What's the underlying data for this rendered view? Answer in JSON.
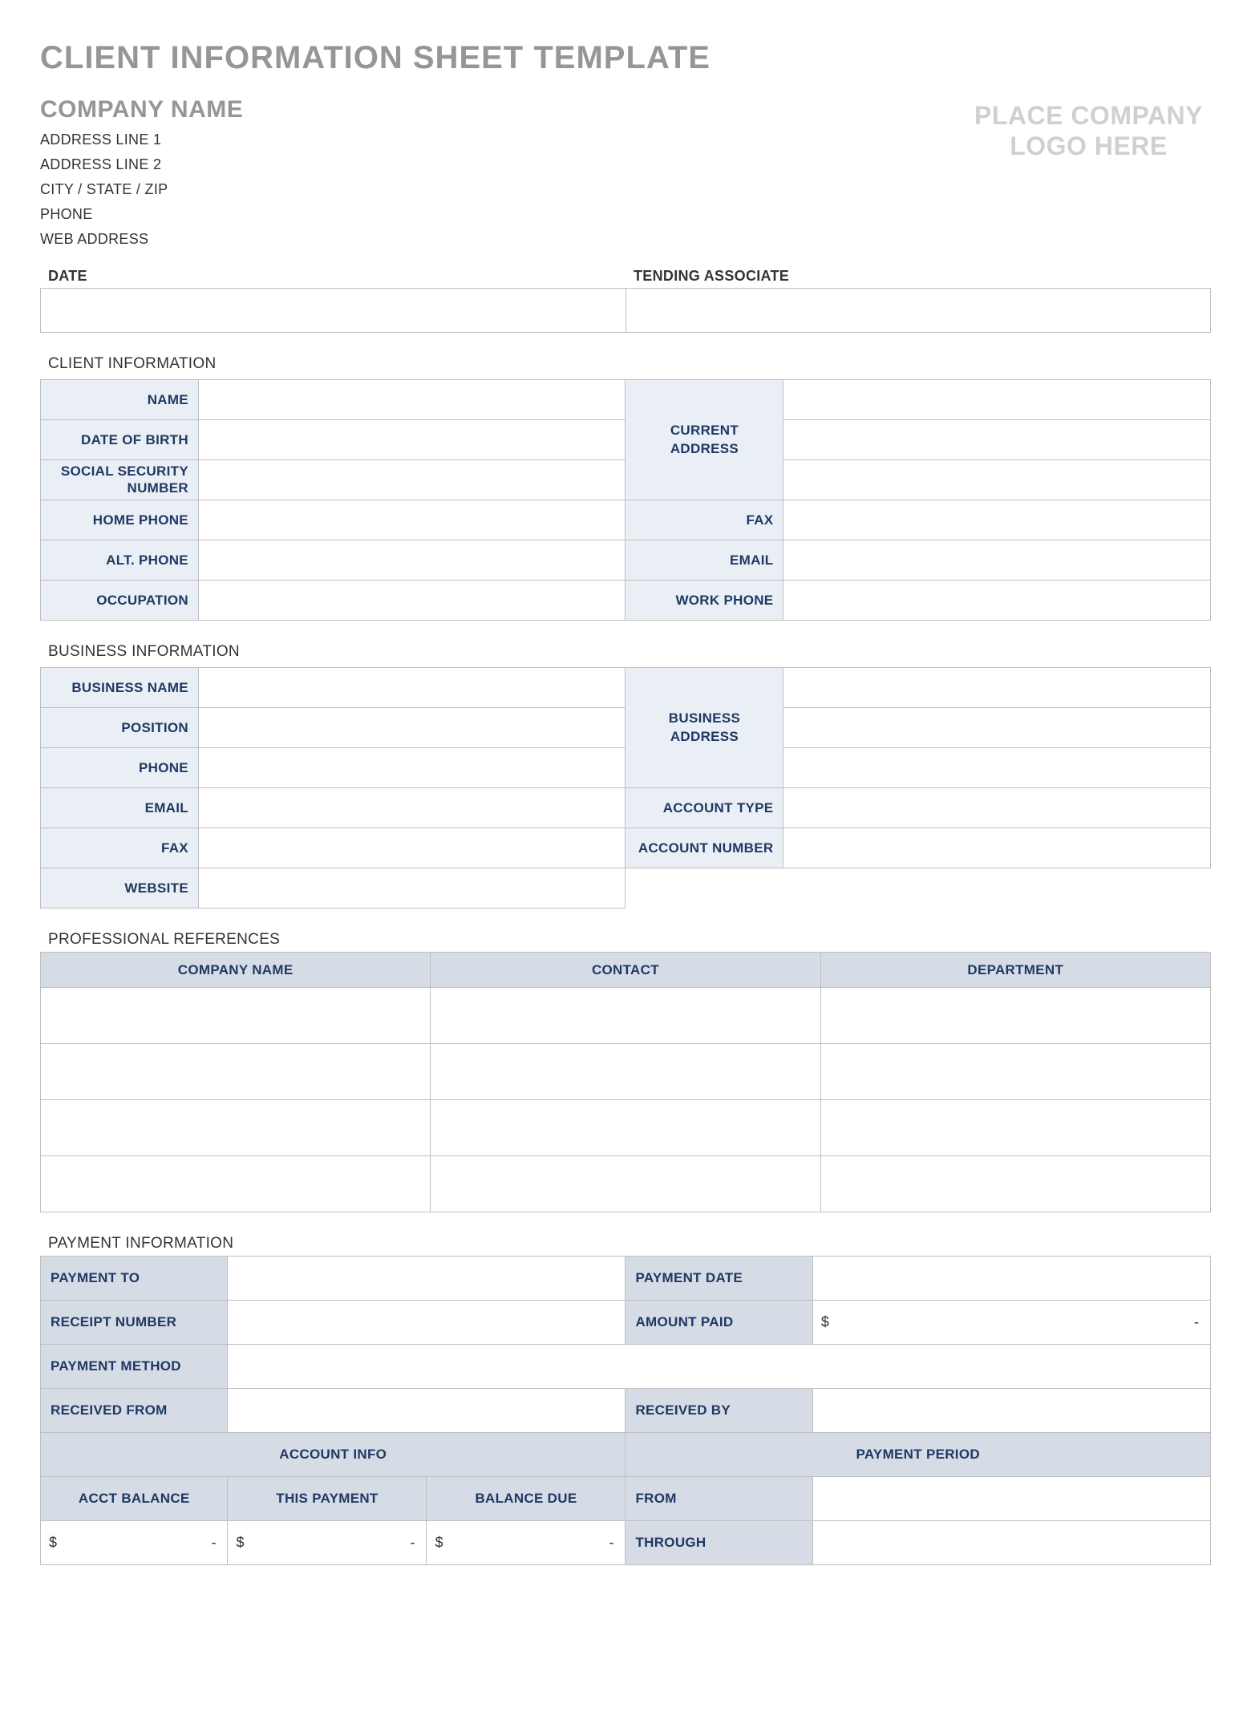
{
  "title": "CLIENT INFORMATION SHEET TEMPLATE",
  "company": {
    "name": "COMPANY NAME",
    "addr1": "ADDRESS LINE 1",
    "addr2": "ADDRESS LINE 2",
    "csz": "CITY / STATE / ZIP",
    "phone": "PHONE",
    "web": "WEB ADDRESS",
    "logo_line1": "PLACE COMPANY",
    "logo_line2": "LOGO HERE"
  },
  "top": {
    "date_label": "DATE",
    "associate_label": "TENDING ASSOCIATE"
  },
  "client": {
    "section": "CLIENT INFORMATION",
    "name": "NAME",
    "dob": "DATE OF BIRTH",
    "ssn": "SOCIAL SECURITY NUMBER",
    "home_phone": "HOME PHONE",
    "alt_phone": "ALT. PHONE",
    "occupation": "OCCUPATION",
    "current_address": "CURRENT ADDRESS",
    "fax": "FAX",
    "email": "EMAIL",
    "work_phone": "WORK PHONE"
  },
  "business": {
    "section": "BUSINESS INFORMATION",
    "name": "BUSINESS NAME",
    "position": "POSITION",
    "phone": "PHONE",
    "email": "EMAIL",
    "fax": "FAX",
    "website": "WEBSITE",
    "address": "BUSINESS ADDRESS",
    "acct_type": "ACCOUNT TYPE",
    "acct_num": "ACCOUNT NUMBER"
  },
  "references": {
    "section": "PROFESSIONAL REFERENCES",
    "col1": "COMPANY NAME",
    "col2": "CONTACT",
    "col3": "DEPARTMENT"
  },
  "payment": {
    "section": "PAYMENT INFORMATION",
    "payment_to": "PAYMENT TO",
    "receipt_no": "RECEIPT NUMBER",
    "payment_method": "PAYMENT METHOD",
    "received_from": "RECEIVED FROM",
    "payment_date": "PAYMENT DATE",
    "amount_paid": "AMOUNT PAID",
    "received_by": "RECEIVED BY",
    "account_info": "ACCOUNT INFO",
    "payment_period": "PAYMENT PERIOD",
    "acct_balance": "ACCT BALANCE",
    "this_payment": "THIS PAYMENT",
    "balance_due": "BALANCE DUE",
    "from": "FROM",
    "through": "THROUGH",
    "dollar": "$",
    "dash": "-"
  }
}
